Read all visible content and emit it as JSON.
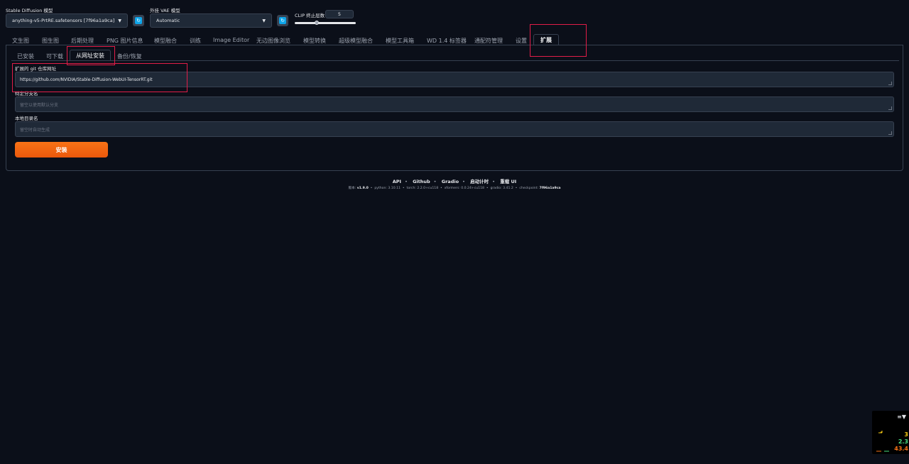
{
  "top": {
    "sd_model_label": "Stable Diffusion 模型",
    "sd_model_value": "anything-v5-PrtRE.safetensors [7f96a1a9ca]",
    "vae_label": "外挂 VAE 模型",
    "vae_value": "Automatic",
    "clip_label": "CLIP 终止层数",
    "clip_value": "5",
    "clip_slider_fraction": 0.375
  },
  "tabs": [
    "文生图",
    "图生图",
    "后期处理",
    "PNG 图片信息",
    "模型融合",
    "训练",
    "Image Editor",
    "无边图像浏览",
    "模型转换",
    "超级模型融合",
    "模型工具箱",
    "WD 1.4 标签器",
    "通配符管理",
    "设置",
    "扩展"
  ],
  "active_tab": "扩展",
  "subtabs": [
    "已安装",
    "可下载",
    "从网址安装",
    "备份/恢复"
  ],
  "active_subtab": "从网址安装",
  "form": {
    "url_label": "扩展的 git 仓库网址",
    "url_value": "https://github.com/NVIDIA/Stable-Diffusion-WebUI-TensorRT.git",
    "branch_label": "特定分支名",
    "branch_placeholder": "留空以使用默认分支",
    "dir_label": "本地目录名",
    "dir_placeholder": "留空时自动生成",
    "install_label": "安装"
  },
  "footer": {
    "links": [
      "API",
      "Github",
      "Gradio",
      "启动计时",
      "重载 UI"
    ],
    "version_label": "版本:",
    "version": "v1.9.0",
    "python_label": "python:",
    "python": "3.10.11",
    "torch_label": "torch:",
    "torch": "2.2.0+cu118",
    "xformers_label": "xformers:",
    "xformers": "0.0.24+cu118",
    "gradio_label": "gradio:",
    "gradio": "3.41.2",
    "checkpoint_label": "checkpoint:",
    "checkpoint": "7f96a1a9ca"
  },
  "perf": {
    "menu_icon": "≡▼",
    "v1": "3",
    "v2": "2.3",
    "v3": "43.4",
    "colors": {
      "v1": "#facc15",
      "v2": "#4ade80",
      "v3": "#f97316"
    }
  },
  "colors": {
    "accent": "#f97316",
    "highlight": "#e11d48",
    "background": "#0b0f19"
  }
}
